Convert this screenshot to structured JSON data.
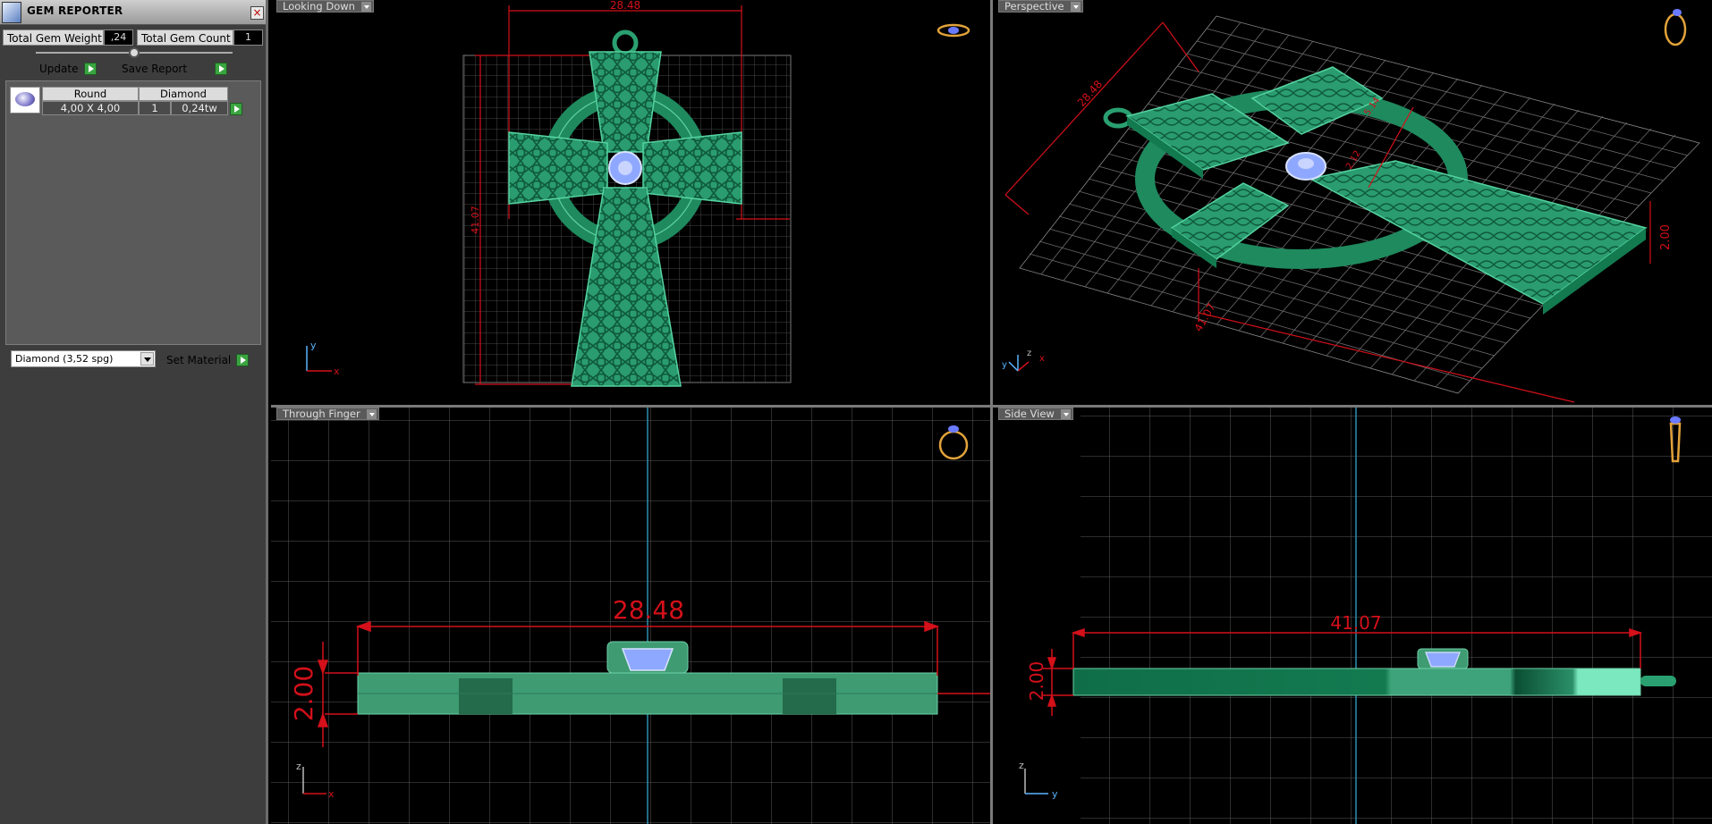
{
  "panel": {
    "title": "GEM REPORTER",
    "close": "×",
    "total_gem_weight_label": "Total Gem Weight",
    "total_gem_weight_value": ",24",
    "total_gem_count_label": "Total Gem Count",
    "total_gem_count_value": "1",
    "update_label": "Update",
    "save_report_label": "Save Report",
    "gem_headers": [
      "Round",
      "Diamond"
    ],
    "gem_row": {
      "size": "4,00 X 4,00",
      "count": "1",
      "weight": "0,24tw"
    },
    "material_select": "Diamond    (3,52 spg)",
    "set_material_label": "Set Material"
  },
  "viewports": {
    "top_left": {
      "label": "Looking Down",
      "dim_width": "28.48",
      "dim_height": "41.07",
      "axis_x": "x",
      "axis_y": "y"
    },
    "top_right": {
      "label": "Perspective",
      "dim_a": "28.48",
      "dim_b": "41.07",
      "dim_c": "2.00",
      "dim_d": "5.14",
      "dim_e": "2.12",
      "axis_x": "x",
      "axis_y": "y",
      "axis_z": "z"
    },
    "bottom_left": {
      "label": "Through Finger",
      "dim_width": "28.48",
      "dim_height": "2.00",
      "axis_x": "x",
      "axis_z": "z"
    },
    "bottom_right": {
      "label": "Side View",
      "dim_width": "41.07",
      "dim_height": "2.00",
      "axis_y": "y",
      "axis_z": "z"
    }
  },
  "colors": {
    "accent_green": "#2f9e6e",
    "dimension_red": "#d4101a",
    "gem_blue": "#8fa8ff"
  }
}
